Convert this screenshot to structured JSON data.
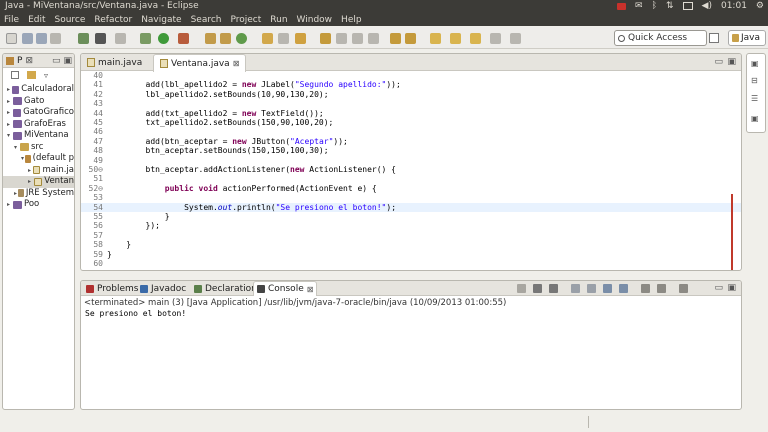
{
  "window": {
    "title": "Java - MiVentana/src/Ventana.java - Eclipse"
  },
  "tray": {
    "clock": "01:01"
  },
  "menubar": [
    "File",
    "Edit",
    "Source",
    "Refactor",
    "Navigate",
    "Search",
    "Project",
    "Run",
    "Window",
    "Help"
  ],
  "toolbar": {
    "quick_access_placeholder": "Quick Access",
    "perspective_label": "Java"
  },
  "package_explorer": {
    "tab_label": "P",
    "tree": [
      {
        "label": "Calculadoral",
        "depth": 0,
        "type": "project",
        "expander": "▸"
      },
      {
        "label": "Gato",
        "depth": 0,
        "type": "project",
        "expander": "▸"
      },
      {
        "label": "GatoGrafico",
        "depth": 0,
        "type": "project",
        "expander": "▸"
      },
      {
        "label": "GrafoEras",
        "depth": 0,
        "type": "project",
        "expander": "▸"
      },
      {
        "label": "MiVentana",
        "depth": 0,
        "type": "project",
        "expander": "▾"
      },
      {
        "label": "src",
        "depth": 1,
        "type": "folder",
        "expander": "▾"
      },
      {
        "label": "(default p",
        "depth": 2,
        "type": "package",
        "expander": "▾"
      },
      {
        "label": "main.ja",
        "depth": 3,
        "type": "java",
        "expander": "▸"
      },
      {
        "label": "Ventan",
        "depth": 3,
        "type": "java",
        "expander": "▸",
        "selected": true
      },
      {
        "label": "JRE System",
        "depth": 1,
        "type": "lib",
        "expander": "▸"
      },
      {
        "label": "Poo",
        "depth": 0,
        "type": "project",
        "expander": "▸"
      }
    ]
  },
  "editor": {
    "tabs": [
      {
        "label": "main.java",
        "active": false
      },
      {
        "label": "Ventana.java",
        "active": true,
        "close": "⊠"
      }
    ],
    "lines": [
      {
        "n": "40",
        "html": ""
      },
      {
        "n": "41",
        "html": "        add(lbl_apellido2 = <span class=\"kw\">new</span> JLabel(<span class=\"str\">\"Segundo apellido:\"</span>));"
      },
      {
        "n": "42",
        "html": "        lbl_apellido2.setBounds(10,90,130,20);"
      },
      {
        "n": "43",
        "html": ""
      },
      {
        "n": "44",
        "html": "        add(txt_apellido2 = <span class=\"kw\">new</span> TextField());"
      },
      {
        "n": "45",
        "html": "        txt_apellido2.setBounds(150,90,100,20);"
      },
      {
        "n": "46",
        "html": ""
      },
      {
        "n": "47",
        "html": "        add(btn_aceptar = <span class=\"kw\">new</span> JButton(<span class=\"str\">\"Aceptar\"</span>));"
      },
      {
        "n": "48",
        "html": "        btn_aceptar.setBounds(150,150,100,30);"
      },
      {
        "n": "49",
        "html": ""
      },
      {
        "n": "50⊖",
        "html": "        btn_aceptar.addActionListener(<span class=\"kw\">new</span> ActionListener() {"
      },
      {
        "n": "51",
        "html": ""
      },
      {
        "n": "52⊖",
        "html": "            <span class=\"kw\">public void</span> actionPerformed(ActionEvent e) {"
      },
      {
        "n": "53",
        "html": ""
      },
      {
        "n": "54",
        "html": "                System.<span class=\"it\">out</span>.println(<span class=\"str\">\"Se presiono el boton!\"</span>);",
        "current": true
      },
      {
        "n": "55",
        "html": "            }"
      },
      {
        "n": "56",
        "html": "        });"
      },
      {
        "n": "57",
        "html": ""
      },
      {
        "n": "58",
        "html": "    }"
      },
      {
        "n": "59",
        "html": "}"
      },
      {
        "n": "60",
        "html": ""
      }
    ]
  },
  "bottom_panel": {
    "tabs": [
      {
        "label": "Problems",
        "active": false,
        "color": "#b03030"
      },
      {
        "label": "Javadoc",
        "active": false,
        "color": "#3a6aa8",
        "glyph": "@"
      },
      {
        "label": "Declaration",
        "active": false,
        "color": "#5a7f4a"
      },
      {
        "label": "Console",
        "active": true,
        "color": "#444444",
        "close": "⊠"
      }
    ],
    "terminated_line": "<terminated> main (3) [Java Application] /usr/lib/jvm/java-7-oracle/bin/java (10/09/2013 01:00:55)",
    "output": "Se presiono el boton!"
  }
}
